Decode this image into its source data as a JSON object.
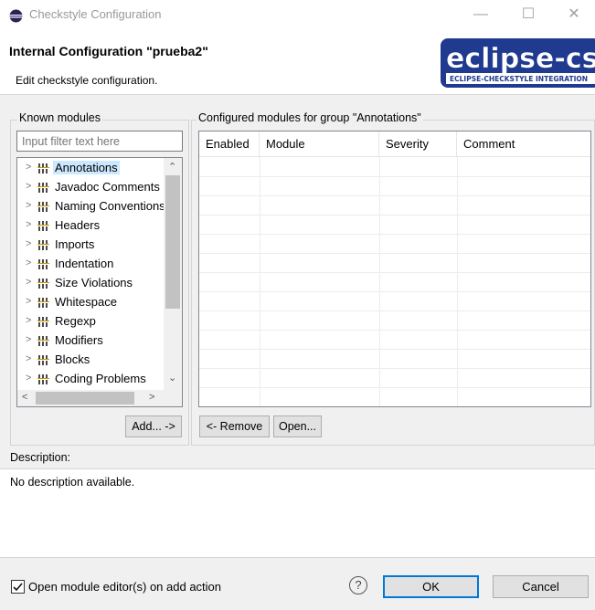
{
  "window": {
    "title": "Checkstyle Configuration",
    "minimize_glyph": "—",
    "maximize_glyph": "☐",
    "close_glyph": "✕"
  },
  "header": {
    "title": "Internal Configuration \"prueba2\"",
    "subtitle": "Edit checkstyle configuration.",
    "logo_text": "eclipse-cs",
    "logo_subtext": "ECLIPSE-CHECKSTYLE INTEGRATION"
  },
  "known_modules": {
    "group_label": "Known modules",
    "filter_placeholder": "Input filter text here",
    "items": [
      {
        "label": "Annotations",
        "selected": true
      },
      {
        "label": "Javadoc Comments"
      },
      {
        "label": "Naming Conventions"
      },
      {
        "label": "Headers"
      },
      {
        "label": "Imports"
      },
      {
        "label": "Indentation"
      },
      {
        "label": "Size Violations"
      },
      {
        "label": "Whitespace"
      },
      {
        "label": "Regexp"
      },
      {
        "label": "Modifiers"
      },
      {
        "label": "Blocks"
      },
      {
        "label": "Coding Problems"
      }
    ],
    "add_button": "Add... ->"
  },
  "configured_modules": {
    "group_label": "Configured modules for group \"Annotations\"",
    "columns": [
      "Enabled",
      "Module",
      "Severity",
      "Comment"
    ],
    "remove_button": "<- Remove",
    "open_button": "Open..."
  },
  "description": {
    "label": "Description:",
    "text": "No description available."
  },
  "footer": {
    "open_editor_checkbox": "Open module editor(s) on add action",
    "open_editor_checked": true,
    "help_glyph": "?",
    "ok_button": "OK",
    "cancel_button": "Cancel"
  },
  "colors": {
    "selection": "#cce8ff",
    "default_button_border": "#0078d7",
    "logo_blue": "#1f3a8f"
  }
}
